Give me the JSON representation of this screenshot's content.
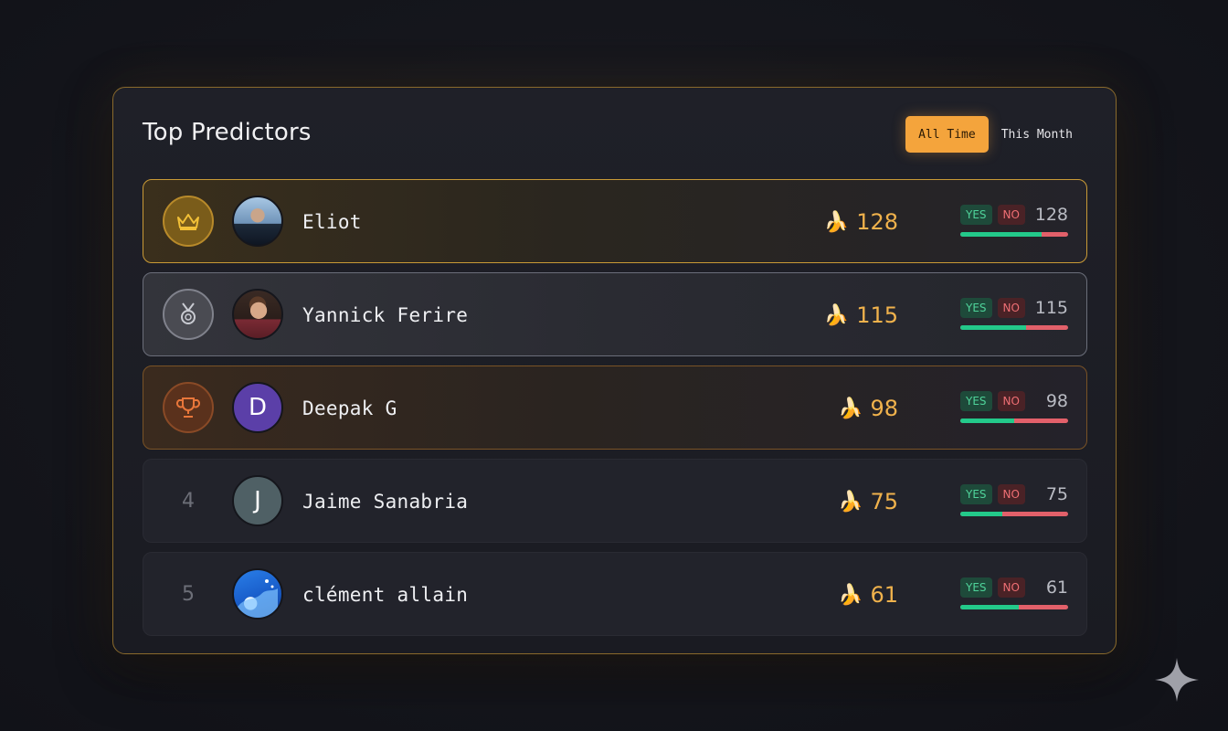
{
  "leaderboard": {
    "title": "Top Predictors",
    "filters": [
      {
        "label": "All Time",
        "active": true
      },
      {
        "label": "This Month",
        "active": false
      }
    ],
    "rows": [
      {
        "rank": "1",
        "rank_icon": "crown-icon",
        "avatar": "photo",
        "name": "Eliot",
        "score": "128",
        "yes_label": "YES",
        "no_label": "NO",
        "count": "128",
        "yes_fraction": 0.75
      },
      {
        "rank": "2",
        "rank_icon": "medal-icon",
        "avatar": "photo",
        "name": "Yannick Ferire",
        "score": "115",
        "yes_label": "YES",
        "no_label": "NO",
        "count": "115",
        "yes_fraction": 0.61
      },
      {
        "rank": "3",
        "rank_icon": "trophy-icon",
        "avatar": "D",
        "name": "Deepak G",
        "score": "98",
        "yes_label": "YES",
        "no_label": "NO",
        "count": "98",
        "yes_fraction": 0.5
      },
      {
        "rank": "4",
        "avatar": "J",
        "name": "Jaime Sanabria",
        "score": "75",
        "yes_label": "YES",
        "no_label": "NO",
        "count": "75",
        "yes_fraction": 0.39
      },
      {
        "rank": "5",
        "avatar": "wave",
        "name": "clément allain",
        "score": "61",
        "yes_label": "YES",
        "no_label": "NO",
        "count": "61",
        "yes_fraction": 0.54
      }
    ]
  },
  "colors": {
    "accent": "#f4a43c",
    "yes": "#23c98a",
    "no": "#e2606a",
    "gold": "#c99a36",
    "silver": "#6b6e7a",
    "bronze": "#7a5326"
  }
}
